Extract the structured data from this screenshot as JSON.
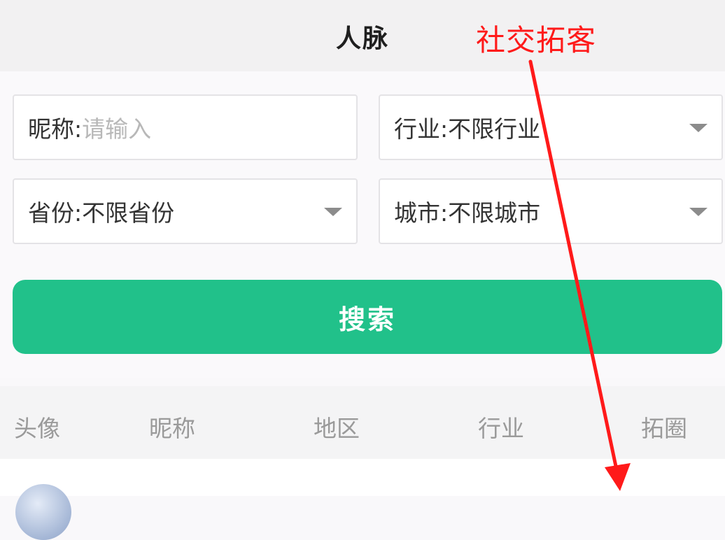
{
  "header": {
    "title": "人脉"
  },
  "annotation": {
    "text": "社交拓客",
    "color": "#ff1a1a"
  },
  "form": {
    "nickname": {
      "label": "昵称:",
      "placeholder": "请输入"
    },
    "industry": {
      "label": "行业:",
      "value": "不限行业"
    },
    "province": {
      "label": "省份:",
      "value": "不限省份"
    },
    "city": {
      "label": "城市:",
      "value": "不限城市"
    },
    "search_label": "搜索"
  },
  "table": {
    "columns": [
      "头像",
      "昵称",
      "地区",
      "行业",
      "拓圈"
    ]
  },
  "colors": {
    "accent": "#21c18a",
    "placeholder": "#b8b8b8",
    "header_text": "#9a9a9a"
  },
  "icons": {
    "dropdown": "caret-down-icon",
    "avatar": "user-avatar"
  }
}
